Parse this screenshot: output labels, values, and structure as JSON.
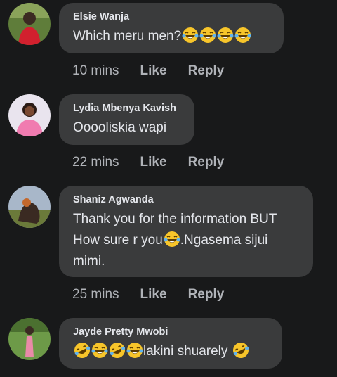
{
  "comments": [
    {
      "author": "Elsie Wanja",
      "text_lines": [
        "Which meru men?"
      ],
      "emoji_after_line0": "laughing-tears-emoji x4",
      "time": "10 mins",
      "like_label": "Like",
      "reply_label": "Reply"
    },
    {
      "author": "Lydia Mbenya Kavish",
      "text_lines": [
        "Ooooliskia wapi"
      ],
      "time": "22 mins",
      "like_label": "Like",
      "reply_label": "Reply"
    },
    {
      "author": "Shaniz Agwanda",
      "text_lines": [
        "Thank you for the information BUT",
        "How sure r you",
        ".Ngasema sijui",
        "mimi."
      ],
      "time": "25 mins",
      "like_label": "Like",
      "reply_label": "Reply"
    },
    {
      "author": "Jayde Pretty Mwobi",
      "text_lines": [
        "lakini shuarely"
      ]
    }
  ],
  "colors": {
    "background": "#18191a",
    "bubble": "#3a3b3c",
    "primary_text": "#e4e6eb",
    "secondary_text": "#b0b3b8",
    "emoji_face": "#f7c52a"
  },
  "icons": [
    "laughing-tears-emoji",
    "rolling-laughing-emoji"
  ]
}
